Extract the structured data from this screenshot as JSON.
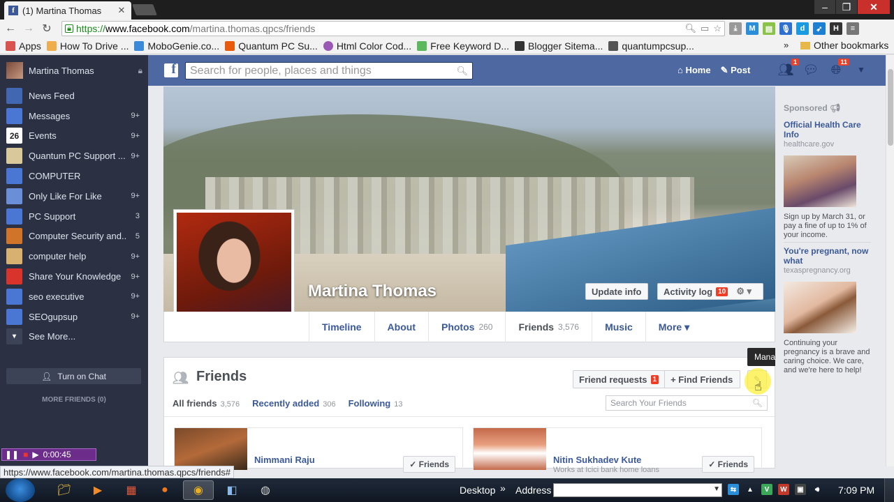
{
  "browser": {
    "tab_title": "(1) Martina Thomas",
    "tab_close": "✕",
    "url_scheme": "https://",
    "url_host": "www.facebook.com",
    "url_path": "/martina.thomas.qpcs/friends",
    "bookmarks": [
      {
        "label": "Apps",
        "color": "#d9534f"
      },
      {
        "label": "How To Drive ...",
        "color": "#f0ad4e"
      },
      {
        "label": "MoboGenie.co...",
        "color": "#3b8ad8"
      },
      {
        "label": "Quantum PC Su...",
        "color": "#e85a0c"
      },
      {
        "label": "Html Color Cod...",
        "color": "#9b59b6"
      },
      {
        "label": "Free Keyword D...",
        "color": "#5cb85c"
      },
      {
        "label": "Blogger Sitema...",
        "color": "#333333"
      },
      {
        "label": "quantumpcsup...",
        "color": "#555555"
      }
    ],
    "bookmarks_more": "»",
    "other_bookmarks": "Other bookmarks",
    "status_url": "https://www.facebook.com/martina.thomas.qpcs/friends#"
  },
  "sidebar": {
    "user_name": "Martina Thomas",
    "items": [
      {
        "label": "News Feed",
        "count": "",
        "icon_color": "#4267b2",
        "glyph": ""
      },
      {
        "label": "Messages",
        "count": "9+",
        "icon_color": "#4a77d4",
        "glyph": ""
      },
      {
        "label": "Events",
        "count": "9+",
        "icon_color": "#ffffff",
        "glyph": "26"
      },
      {
        "label": "Quantum PC Support ...",
        "count": "9+",
        "icon_color": "#d8c89a",
        "glyph": ""
      },
      {
        "label": "COMPUTER",
        "count": "",
        "icon_color": "#4a77d4",
        "glyph": ""
      },
      {
        "label": "Only Like For Like",
        "count": "9+",
        "icon_color": "#6a8fd8",
        "glyph": ""
      },
      {
        "label": "PC Support",
        "count": "3",
        "icon_color": "#4a77d4",
        "glyph": ""
      },
      {
        "label": "Computer Security and...",
        "count": "5",
        "icon_color": "#d0742a",
        "glyph": ""
      },
      {
        "label": "computer help",
        "count": "9+",
        "icon_color": "#d8b070",
        "glyph": ""
      },
      {
        "label": "Share Your Knowledge",
        "count": "9+",
        "icon_color": "#d9342b",
        "glyph": ""
      },
      {
        "label": "seo executive",
        "count": "9+",
        "icon_color": "#4a77d4",
        "glyph": ""
      },
      {
        "label": "SEOgupsup",
        "count": "9+",
        "icon_color": "#4a77d4",
        "glyph": ""
      },
      {
        "label": "See More...",
        "count": "",
        "icon_color": "#3c4357",
        "glyph": "▾"
      }
    ],
    "chat_button": "Turn on Chat",
    "more_friends": "MORE FRIENDS (0)",
    "recorder_time": "0:00:45"
  },
  "fbbar": {
    "logo": "f",
    "search_placeholder": "Search for people, places and things",
    "home": "Home",
    "post": "Post",
    "friend_req_badge": "1",
    "notif_badge": "11"
  },
  "profile": {
    "name": "Martina Thomas",
    "update_info": "Update info",
    "activity_log": "Activity log",
    "activity_count": "10",
    "tabs": [
      {
        "label": "Timeline",
        "count": ""
      },
      {
        "label": "About",
        "count": ""
      },
      {
        "label": "Photos",
        "count": "260"
      },
      {
        "label": "Friends",
        "count": "3,576"
      },
      {
        "label": "Music",
        "count": ""
      },
      {
        "label": "More ▾",
        "count": ""
      }
    ]
  },
  "friends": {
    "heading": "Friends",
    "friend_requests": "Friend requests",
    "requests_badge": "1",
    "find_friends": "+ Find Friends",
    "tooltip": "Manage",
    "subtabs": [
      {
        "label": "All friends",
        "count": "3,576"
      },
      {
        "label": "Recently added",
        "count": "306"
      },
      {
        "label": "Following",
        "count": "13"
      }
    ],
    "search_placeholder": "Search Your Friends",
    "cards": [
      {
        "name": "Nimmani Raju",
        "sub": "",
        "button": "✓ Friends"
      },
      {
        "name": "Nitin Sukhadev Kute",
        "sub": "Works at Icici bank home loans",
        "button": "✓ Friends"
      }
    ]
  },
  "rightcol": {
    "sponsored": "Sponsored",
    "ads": [
      {
        "title": "Official Health Care Info",
        "url": "healthcare.gov",
        "desc": "Sign up by March 31, or pay a fine of up to 1% of your income."
      },
      {
        "title": "You're pregnant, now what",
        "url": "texaspregnancy.org",
        "desc": "Continuing your pregnancy is a brave and caring choice. We care, and we're here to help!"
      }
    ]
  },
  "taskbar": {
    "desktop": "Desktop",
    "address": "Address",
    "clock": "7:09 PM"
  }
}
